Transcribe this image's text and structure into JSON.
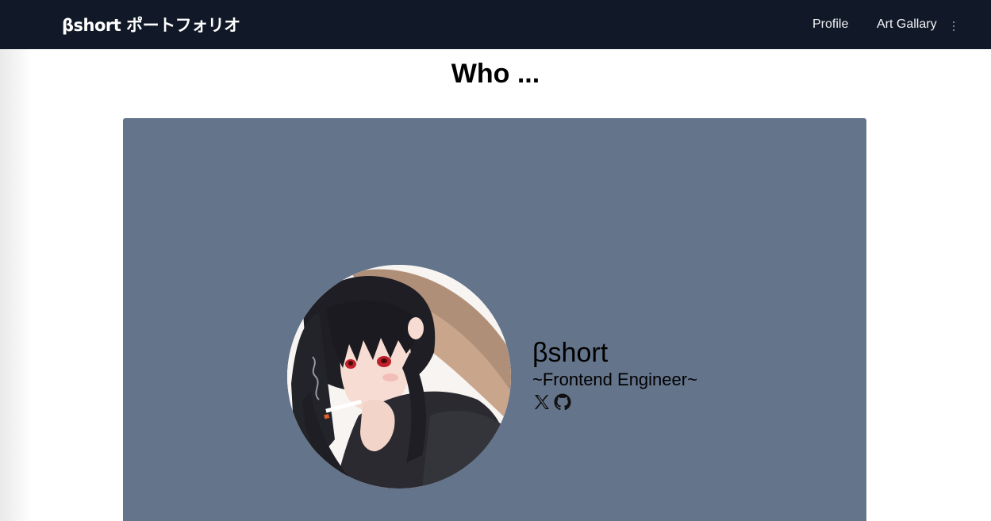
{
  "header": {
    "brand": "βshort ポートフォリオ",
    "nav": [
      {
        "label": "Profile"
      },
      {
        "label": "Art Gallary"
      }
    ],
    "more_icon": "vertical-dots-icon",
    "background": "#111827"
  },
  "main": {
    "title": "Who ...",
    "card": {
      "background": "#64748b",
      "avatar": "anime-girl-portrait",
      "name": "βshort",
      "role": "~Frontend Engineer~",
      "socials": [
        {
          "icon": "x-logo-icon"
        },
        {
          "icon": "github-icon"
        }
      ]
    }
  }
}
